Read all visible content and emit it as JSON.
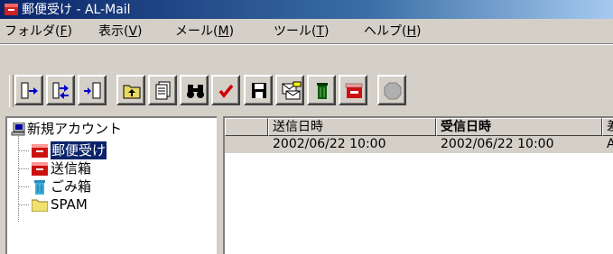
{
  "window": {
    "title": "郵便受け - AL-Mail"
  },
  "menu": [
    {
      "text": "フォルダ(",
      "acc": "F",
      "tail": ")"
    },
    {
      "text": "表示(",
      "acc": "V",
      "tail": ")"
    },
    {
      "text": "メール(",
      "acc": "M",
      "tail": ")"
    },
    {
      "text": "ツール(",
      "acc": "T",
      "tail": ")"
    },
    {
      "text": "ヘルプ(",
      "acc": "H",
      "tail": ")"
    }
  ],
  "toolbar": {
    "buttons": [
      {
        "name": "receive-mail-button",
        "icon": "receive-icon"
      },
      {
        "name": "send-receive-button",
        "icon": "send-receive-icon"
      },
      {
        "name": "send-mail-button",
        "icon": "send-icon"
      },
      {
        "name": "up-folder-button",
        "icon": "up-folder-icon"
      },
      {
        "name": "new-message-button",
        "icon": "compose-icon"
      },
      {
        "name": "find-button",
        "icon": "binoculars-icon"
      },
      {
        "name": "mark-button",
        "icon": "checkmark-icon"
      },
      {
        "name": "save-button",
        "icon": "floppy-icon"
      },
      {
        "name": "reply-button",
        "icon": "envelope-icon"
      },
      {
        "name": "delete-button",
        "icon": "trash-icon"
      },
      {
        "name": "outbox-button",
        "icon": "mailbox-icon"
      },
      {
        "name": "stop-button",
        "icon": "stop-icon"
      }
    ]
  },
  "tree": {
    "account": "新規アカウント",
    "folders": [
      {
        "label": "郵便受け",
        "icon": "inbox-icon",
        "selected": true
      },
      {
        "label": "送信箱",
        "icon": "outbox-icon",
        "selected": false
      },
      {
        "label": "ごみ箱",
        "icon": "trash-icon",
        "selected": false
      },
      {
        "label": "SPAM",
        "icon": "folder-icon",
        "selected": false
      }
    ]
  },
  "list": {
    "columns": [
      "送信日時",
      "受信日時",
      "差"
    ],
    "rows": [
      {
        "sent": "2002/06/22 10:00",
        "received": "2002/06/22 10:00",
        "from": "A"
      }
    ]
  }
}
